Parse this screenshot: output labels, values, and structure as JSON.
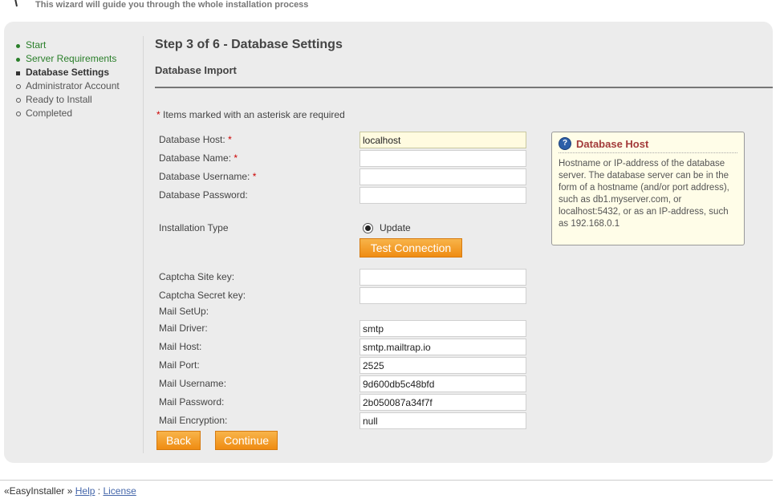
{
  "header": {
    "tagline": "This wizard will guide you through the whole installation process"
  },
  "steps": [
    {
      "label": "Start",
      "state": "done"
    },
    {
      "label": "Server Requirements",
      "state": "done"
    },
    {
      "label": "Database Settings",
      "state": "current"
    },
    {
      "label": "Administrator Account",
      "state": "todo"
    },
    {
      "label": "Ready to Install",
      "state": "todo"
    },
    {
      "label": "Completed",
      "state": "todo"
    }
  ],
  "main": {
    "step_title": "Step 3 of 6 - Database Settings",
    "section_title": "Database Import",
    "required_note": "Items marked with an asterisk are required",
    "required_star": "*"
  },
  "form": {
    "db_host": {
      "label": "Database Host:",
      "value": ""
    },
    "db_host_value": "localhost",
    "db_name": {
      "label": "Database Name:",
      "value": ""
    },
    "db_username": {
      "label": "Database Username:",
      "value": ""
    },
    "db_password": {
      "label": "Database Password:",
      "value": ""
    },
    "install_type": {
      "label": "Installation Type",
      "option": "Update"
    },
    "test_button": "Test Connection",
    "captcha_site": {
      "label": "Captcha Site key:",
      "value": ""
    },
    "captcha_secret": {
      "label": "Captcha Secret key:",
      "value": ""
    },
    "mail_setup": "Mail SetUp:",
    "mail_driver": {
      "label": "Mail Driver:",
      "value": "smtp"
    },
    "mail_host": {
      "label": "Mail Host:",
      "value": "smtp.mailtrap.io"
    },
    "mail_port": {
      "label": "Mail Port:",
      "value": "2525"
    },
    "mail_username": {
      "label": "Mail Username:",
      "value": "9d600db5c48bfd"
    },
    "mail_password": {
      "label": "Mail Password:",
      "value": "2b050087a34f7f"
    },
    "mail_encryption": {
      "label": "Mail Encryption:",
      "value": "null"
    },
    "back_button": "Back",
    "continue_button": "Continue"
  },
  "help": {
    "icon": "question-icon",
    "icon_glyph": "?",
    "title": "Database Host",
    "text": "Hostname or IP-address of the database server. The database server can be in the form of a hostname (and/or port address), such as db1.myserver.com, or localhost:5432, or as an IP-address, such as 192.168.0.1"
  },
  "footer": {
    "brand": "«EasyInstaller »",
    "help_link": "Help",
    "separator": ":",
    "license_link": "License"
  },
  "colors": {
    "accent_orange": "#ef8c12",
    "done_green": "#2a7f2a",
    "help_title": "#a33b3b",
    "required_red": "#cc0000"
  }
}
